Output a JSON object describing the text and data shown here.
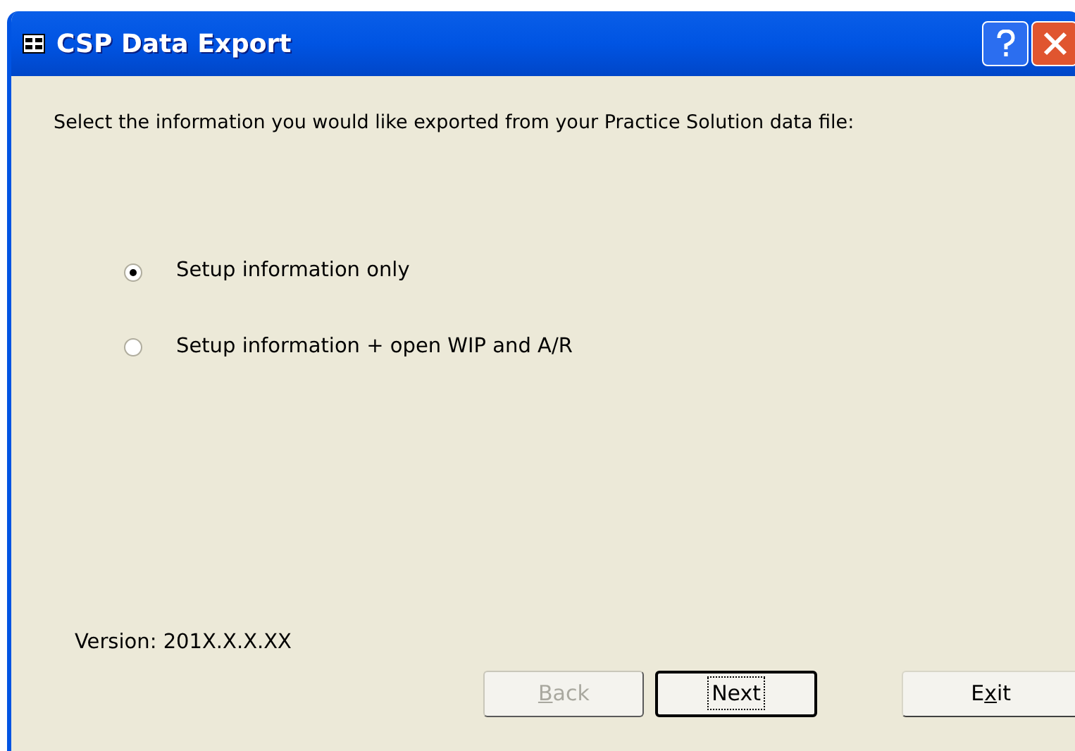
{
  "window": {
    "title": "CSP Data Export"
  },
  "prompt": "Select the information you would like exported from your Practice Solution data file:",
  "options": [
    {
      "label": "Setup information only",
      "selected": true
    },
    {
      "label": "Setup information + open WIP and A/R",
      "selected": false
    }
  ],
  "version": "Version: 201X.X.X.XX",
  "buttons": [
    {
      "key": "B",
      "after": "ack",
      "disabled": true,
      "default": false
    },
    {
      "after": "Next",
      "disabled": false,
      "default": true
    },
    {
      "before": "E",
      "key": "x",
      "after": "it",
      "disabled": false,
      "default": false
    }
  ]
}
